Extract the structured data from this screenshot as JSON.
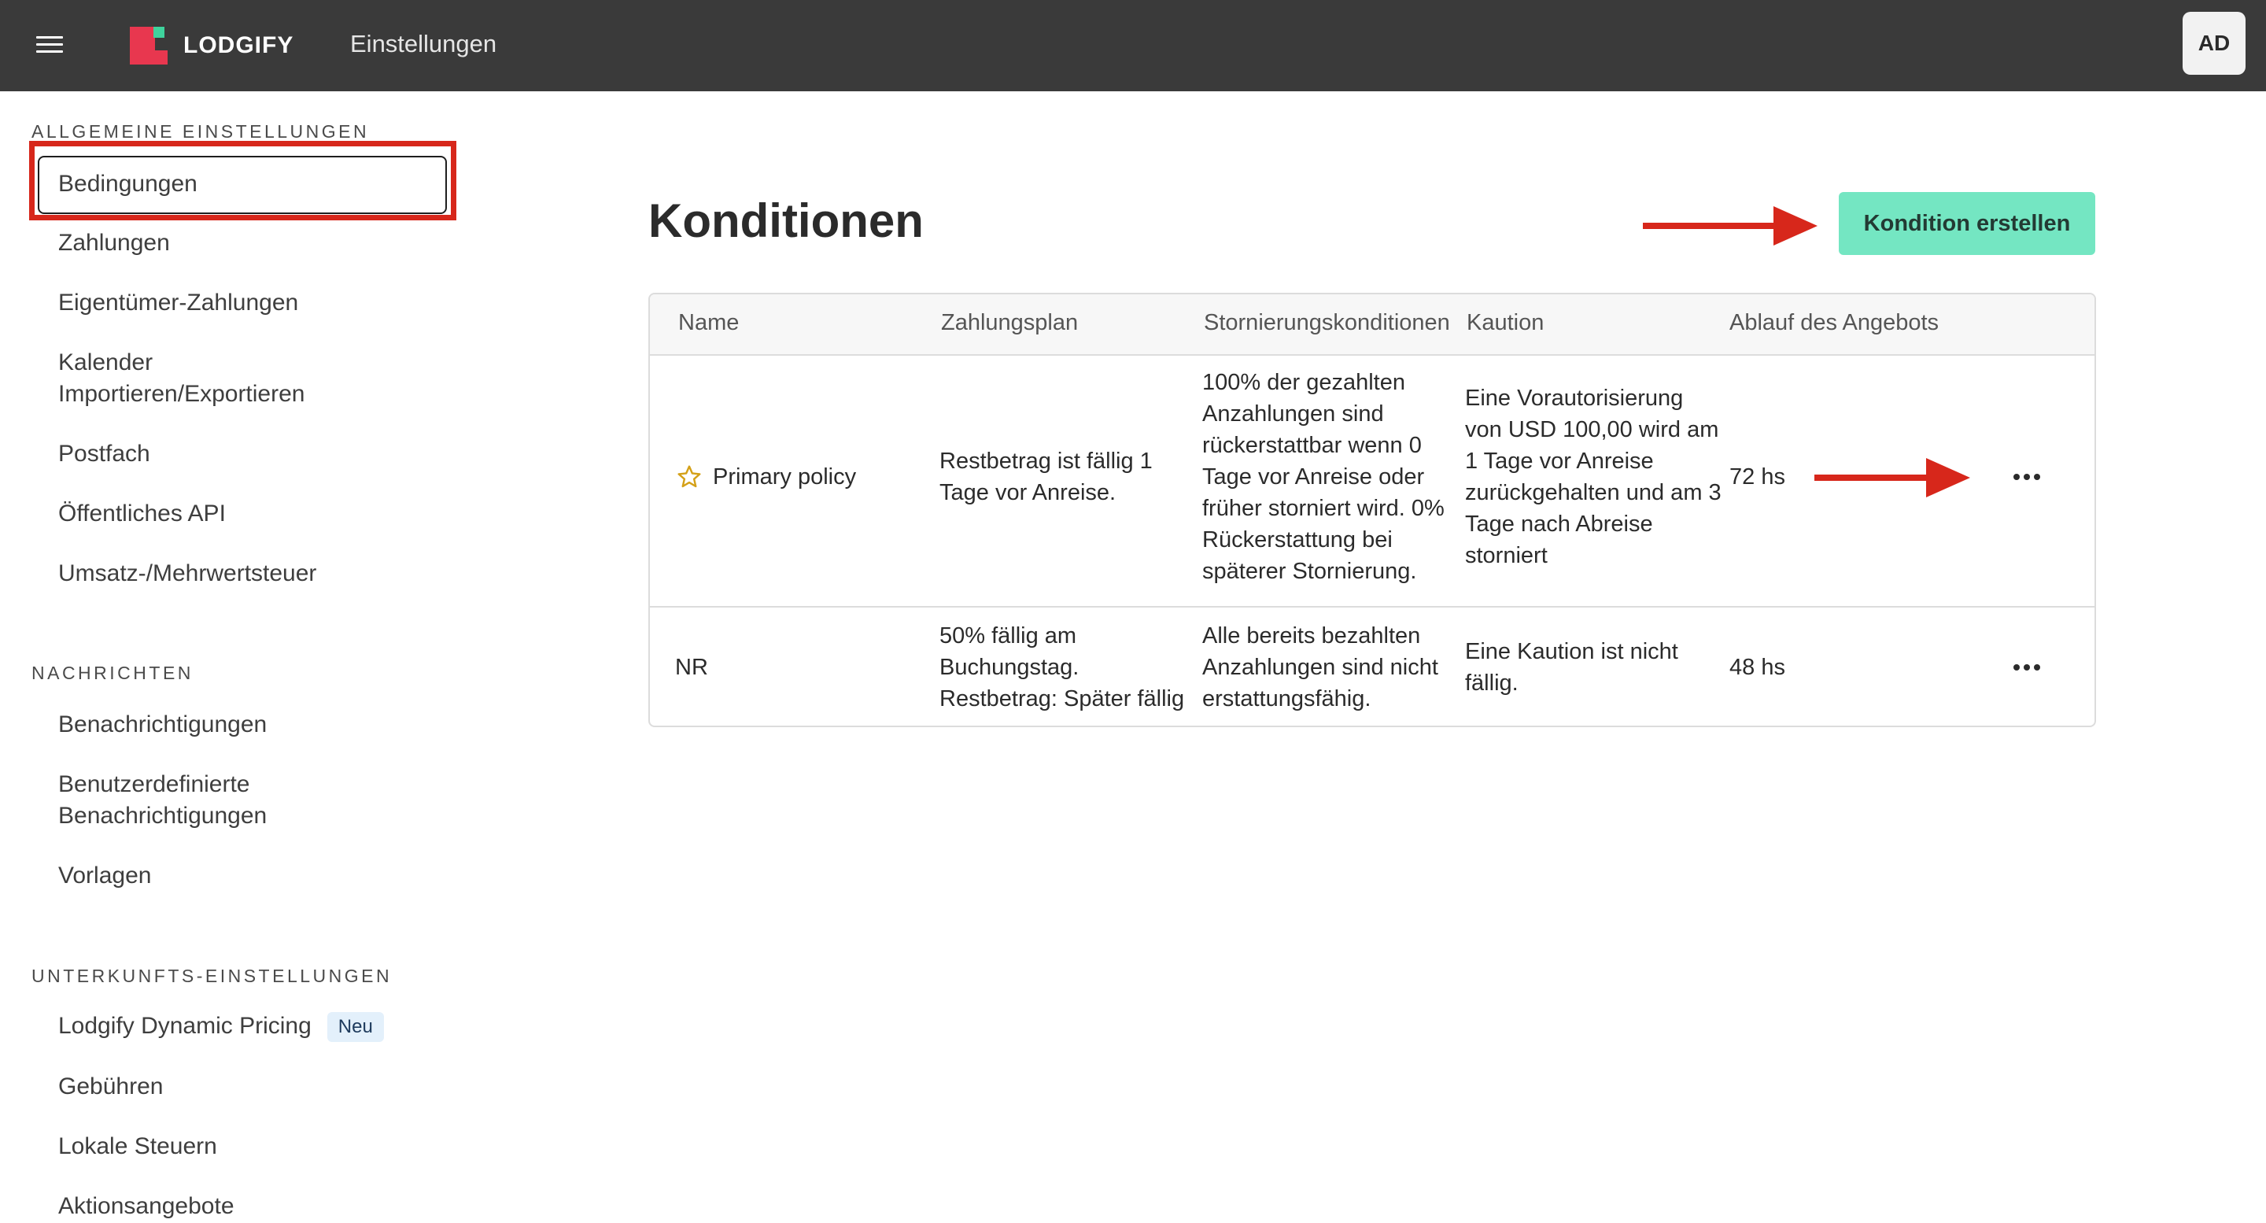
{
  "topbar": {
    "brand": "LODGIFY",
    "title": "Einstellungen",
    "avatar_initials": "AD",
    "brand_color": "#e8374f",
    "brand_accent": "#3fd39d"
  },
  "sidebar": {
    "sections": [
      {
        "heading": "ALLGEMEINE EINSTELLUNGEN",
        "items": [
          {
            "label": "Bedingungen",
            "active": true
          },
          {
            "label": "Zahlungen"
          },
          {
            "label": "Eigentümer-Zahlungen"
          },
          {
            "label": "Kalender Importieren/Exportieren"
          },
          {
            "label": "Postfach"
          },
          {
            "label": "Öffentliches API"
          },
          {
            "label": "Umsatz-/Mehrwertsteuer"
          }
        ]
      },
      {
        "heading": "NACHRICHTEN",
        "items": [
          {
            "label": "Benachrichtigungen"
          },
          {
            "label": "Benutzerdefinierte Benachrichtigungen"
          },
          {
            "label": "Vorlagen"
          }
        ]
      },
      {
        "heading": "UNTERKUNFTS-EINSTELLUNGEN",
        "items": [
          {
            "label": "Lodgify Dynamic Pricing",
            "badge": "Neu"
          },
          {
            "label": "Gebühren"
          },
          {
            "label": "Lokale Steuern"
          },
          {
            "label": "Aktionsangebote"
          }
        ]
      }
    ]
  },
  "main": {
    "title": "Konditionen",
    "create_button": "Kondition erstellen",
    "accent_color": "#74e6c2",
    "annotation_color": "#d7271b",
    "table": {
      "headers": [
        "Name",
        "Zahlungsplan",
        "Stornierungskonditionen",
        "Kaution",
        "Ablauf des Angebots"
      ],
      "rows": [
        {
          "name": "Primary policy",
          "primary": true,
          "payment_plan": "Restbetrag ist fällig 1 Tage vor Anreise.",
          "cancellation": "100% der gezahlten Anzahlungen sind rückerstattbar wenn 0 Tage vor Anreise oder früher storniert wird. 0% Rückerstattung bei späterer Stornierung.",
          "deposit": "Eine Vorautorisierung von USD 100,00 wird am 1 Tage vor Anreise zurückgehalten und am 3 Tage nach Abreise storniert",
          "expiry": "72 hs"
        },
        {
          "name": "NR",
          "primary": false,
          "payment_plan": "50% fällig am Buchungstag. Restbetrag: Später fällig",
          "cancellation": "Alle bereits bezahlten Anzahlungen sind nicht erstattungsfähig.",
          "deposit": "Eine Kaution ist nicht fällig.",
          "expiry": "48 hs"
        }
      ]
    }
  }
}
